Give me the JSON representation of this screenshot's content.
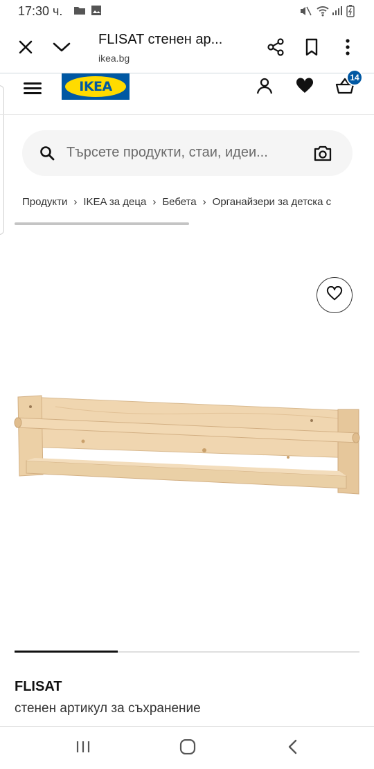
{
  "status_bar": {
    "time": "17:30 ч.",
    "icons": [
      "folder-icon",
      "image-icon",
      "mute-icon",
      "wifi-icon",
      "signal-icon",
      "battery-icon"
    ]
  },
  "browser": {
    "title": "FLISAT стенен ар...",
    "url": "ikea.bg",
    "icons": [
      "close-icon",
      "chevron-down-icon",
      "share-icon",
      "bookmark-icon",
      "more-vert-icon"
    ]
  },
  "header": {
    "logo_text": "IKEA",
    "cart_count": "14",
    "icons": [
      "menu-icon",
      "user-icon",
      "heart-icon",
      "cart-icon"
    ]
  },
  "search": {
    "placeholder": "Търсете продукти, стаи, идеи..."
  },
  "breadcrumb": [
    "Продукти",
    "IKEA за деца",
    "Бебета",
    "Органайзери за детска с"
  ],
  "product": {
    "name": "FLISAT",
    "description": "стенен артикул за съхранение",
    "image_progress": 0.3
  },
  "colors": {
    "ikea_blue": "#0058a3",
    "ikea_yellow": "#ffdb00",
    "wood": "#e9c9a0"
  }
}
